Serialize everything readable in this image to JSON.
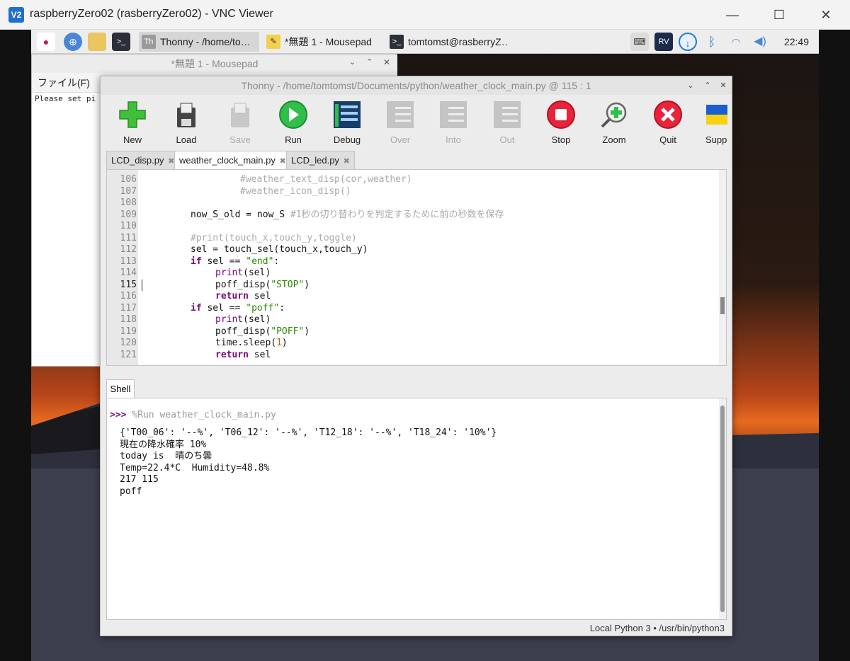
{
  "vnc": {
    "title": "raspberryZero02 (rasberryZero02) - VNC Viewer",
    "logo": "V2",
    "minimize": "—",
    "maximize": "☐",
    "close": "✕"
  },
  "taskbar": {
    "tasks": [
      {
        "label": "Thonny  -  /home/to…"
      },
      {
        "label": "*無題 1 - Mousepad"
      },
      {
        "label": "tomtomst@rasberryZ…"
      }
    ],
    "clock": "22:49"
  },
  "mousepad": {
    "title": "*無題 1 - Mousepad",
    "menu_file": "ファイル(F)",
    "text": "Please set pi"
  },
  "thonny": {
    "title": "Thonny  -  /home/tomtomst/Documents/python/weather_clock_main.py  @  115 : 1",
    "toolbar": [
      {
        "label": "New",
        "icon": "new-icon"
      },
      {
        "label": "Load",
        "icon": "load-icon"
      },
      {
        "label": "Save",
        "icon": "save-icon"
      },
      {
        "label": "Run",
        "icon": "run-icon"
      },
      {
        "label": "Debug",
        "icon": "debug-icon"
      },
      {
        "label": "Over",
        "icon": "step-over-icon"
      },
      {
        "label": "Into",
        "icon": "step-into-icon"
      },
      {
        "label": "Out",
        "icon": "step-out-icon"
      },
      {
        "label": "Stop",
        "icon": "stop-icon"
      },
      {
        "label": "Zoom",
        "icon": "zoom-icon"
      },
      {
        "label": "Quit",
        "icon": "quit-icon"
      },
      {
        "label": "Supp",
        "icon": "support-icon"
      }
    ],
    "tabs": [
      {
        "label": "LCD_disp.py"
      },
      {
        "label": "weather_clock_main.py"
      },
      {
        "label": "LCD_led.py"
      }
    ],
    "tab_close": "✖",
    "line_numbers": [
      "106",
      "107",
      "108",
      "109",
      "110",
      "111",
      "112",
      "113",
      "114",
      "115",
      "116",
      "117",
      "118",
      "119",
      "120",
      "121"
    ],
    "current_line": "115",
    "shell_tab": "Shell",
    "shell": {
      "prompt": ">>>",
      "command": " %Run weather_clock_main.py",
      "output": [
        "{'T00_06': '--%', 'T06_12': '--%', 'T12_18': '--%', 'T18_24': '10%'}",
        "現在の降水確率 10%",
        "today is  晴のち曇",
        "Temp=22.4*C  Humidity=48.8%",
        "217 115",
        "poff"
      ]
    },
    "status": "Local Python 3  •  /usr/bin/python3"
  },
  "code": {
    "l106": "#weather_text_disp(cor,weather)",
    "l107": "#weather_icon_disp()",
    "l109a": "now_S_old = now_S ",
    "l109b": "#1秒の切り替わりを判定するために前の秒数を保存",
    "l111": "#print(touch_x,touch_y,toggle)",
    "l112": "sel = touch_sel(touch_x,touch_y)",
    "kw_if": "if",
    "l113mid": " sel == ",
    "str_end": "\"end\"",
    "colon": ":",
    "fn_print": "print",
    "arg_sel": "(sel)",
    "l115a": "poff_disp(",
    "str_stop": "\"STOP\"",
    "rparen": ")",
    "kw_return": "return",
    "ret_sel": " sel",
    "str_poff": "\"poff\"",
    "str_poff2": "\"POFF\"",
    "l120a": "time.sleep(",
    "num_1": "1"
  },
  "colors": {
    "keyword": "#7a0b80",
    "string": "#2a8a00",
    "comment": "#aaaaaa",
    "number": "#c45a00",
    "prompt": "#7a0b80"
  }
}
